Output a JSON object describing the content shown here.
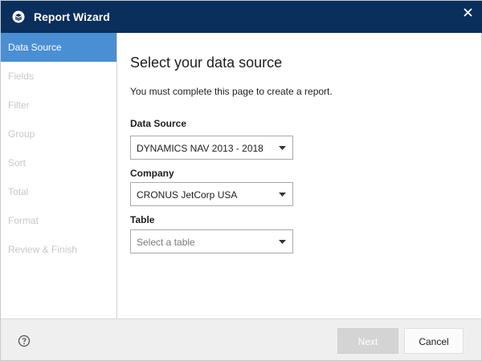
{
  "window": {
    "title": "Report Wizard",
    "app_icon": "report-wizard-icon",
    "close_icon": "close-icon",
    "titlebar_color": "#0a2f5c"
  },
  "sidebar": {
    "accent_color": "#4a8fd3",
    "steps": [
      {
        "label": "Data Source",
        "active": true
      },
      {
        "label": "Fields",
        "active": false
      },
      {
        "label": "Filter",
        "active": false
      },
      {
        "label": "Group",
        "active": false
      },
      {
        "label": "Sort",
        "active": false
      },
      {
        "label": "Total",
        "active": false
      },
      {
        "label": "Format",
        "active": false
      },
      {
        "label": "Review & Finish",
        "active": false
      }
    ]
  },
  "main": {
    "heading": "Select your data source",
    "description": "You must complete this page to create a report.",
    "fields": {
      "data_source": {
        "label": "Data Source",
        "value": "DYNAMICS NAV 2013 - 2018",
        "icon": "chevron-down-icon"
      },
      "company": {
        "label": "Company",
        "value": "CRONUS JetCorp USA",
        "icon": "chevron-down-icon"
      },
      "table": {
        "label": "Table",
        "value": "",
        "placeholder": "Select a table",
        "icon": "chevron-down-icon"
      }
    }
  },
  "footer": {
    "help_icon": "help-icon",
    "next_label": "Next",
    "next_enabled": false,
    "cancel_label": "Cancel"
  }
}
